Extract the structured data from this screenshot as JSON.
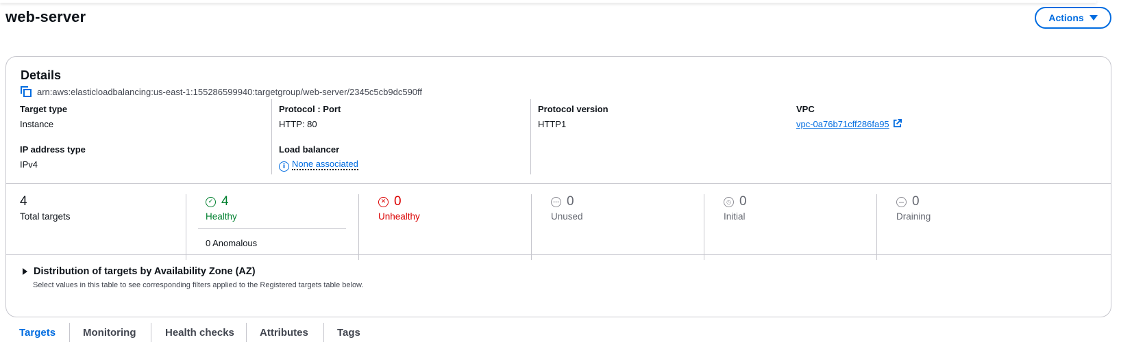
{
  "page_title": "web-server",
  "actions_label": "Actions",
  "details": {
    "title": "Details",
    "arn": "arn:aws:elasticloadbalancing:us-east-1:155286599940:targetgroup/web-server/2345c5cb9dc590ff",
    "fields": {
      "target_type": {
        "label": "Target type",
        "value": "Instance"
      },
      "protocol_port": {
        "label": "Protocol : Port",
        "value": "HTTP: 80"
      },
      "protocol_version": {
        "label": "Protocol version",
        "value": "HTTP1"
      },
      "vpc": {
        "label": "VPC",
        "value": "vpc-0a76b71cff286fa95"
      },
      "ip_address_type": {
        "label": "IP address type",
        "value": "IPv4"
      },
      "load_balancer": {
        "label": "Load balancer",
        "value": "None associated"
      }
    }
  },
  "stats": {
    "total": {
      "value": "4",
      "label": "Total targets"
    },
    "healthy": {
      "value": "4",
      "label": "Healthy",
      "anomalous": "0 Anomalous"
    },
    "unhealthy": {
      "value": "0",
      "label": "Unhealthy"
    },
    "unused": {
      "value": "0",
      "label": "Unused"
    },
    "initial": {
      "value": "0",
      "label": "Initial"
    },
    "draining": {
      "value": "0",
      "label": "Draining"
    }
  },
  "distribution": {
    "title": "Distribution of targets by Availability Zone (AZ)",
    "description": "Select values in this table to see corresponding filters applied to the Registered targets table below."
  },
  "tabs": [
    {
      "label": "Targets",
      "active": true
    },
    {
      "label": "Monitoring",
      "active": false
    },
    {
      "label": "Health checks",
      "active": false
    },
    {
      "label": "Attributes",
      "active": false
    },
    {
      "label": "Tags",
      "active": false
    }
  ],
  "colors": {
    "accent": "#006ce0",
    "healthy": "#00802f",
    "unhealthy": "#db0000",
    "neutral": "#656871"
  }
}
